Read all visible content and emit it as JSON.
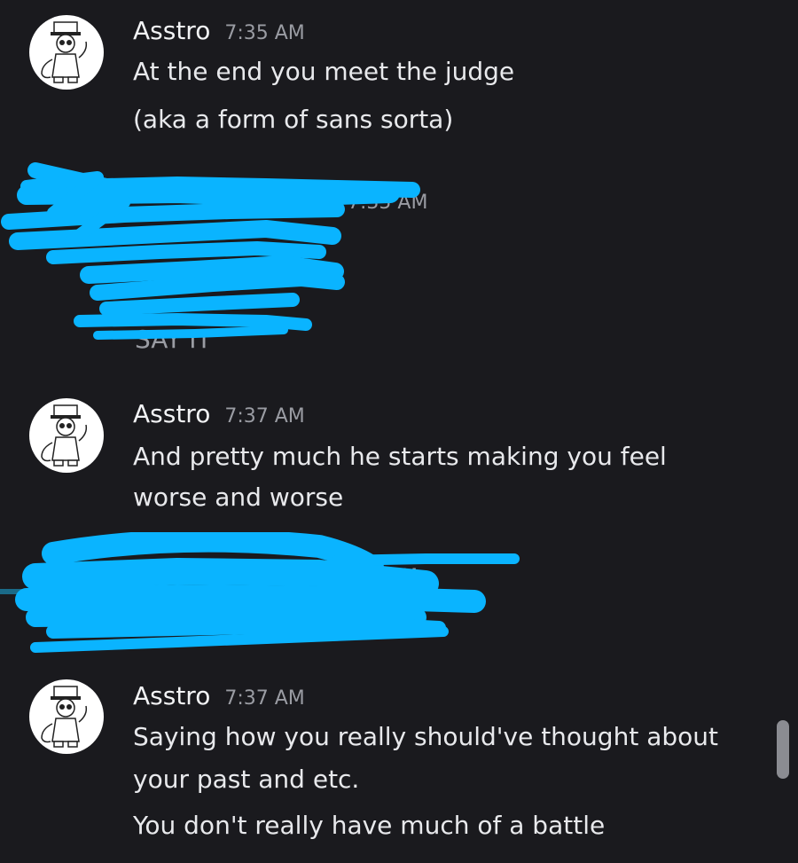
{
  "messages": [
    {
      "author": "Asstro",
      "time": "7:35 AM",
      "lines": [
        "At the end you meet the judge",
        "(aka a form of sans sorta)"
      ]
    },
    {
      "author": "Asstro",
      "time": "7:37 AM",
      "lines": [
        "And pretty much he starts making you feel",
        "worse and worse"
      ]
    },
    {
      "author": "Asstro",
      "time": "7:37 AM",
      "lines": [
        "Saying how you really should've thought about",
        "your past and etc.",
        "You don't really have much of a battle"
      ]
    }
  ],
  "redacted_blocks": [
    {
      "visible_fragment": "7:35 AM",
      "trailing_fragment": "SAY IT"
    },
    {
      "visible_fragment": "M"
    }
  ],
  "colors": {
    "background": "#1a1a1e",
    "scribble": "#0ab4ff",
    "username": "#f2f3f5",
    "timestamp": "#9a9ca3"
  },
  "icons": {
    "avatar": "cartoon-character-avatar-icon"
  }
}
